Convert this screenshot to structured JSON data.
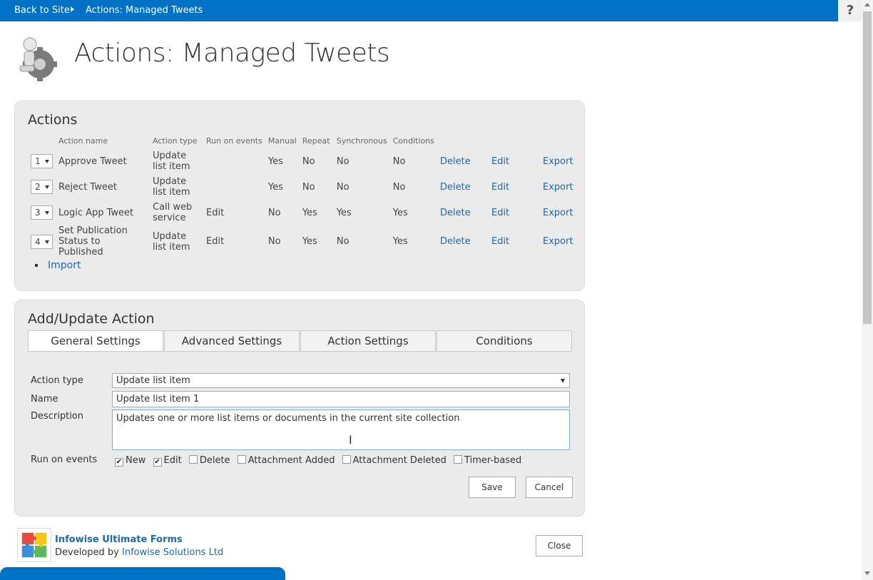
{
  "topbar": {
    "back_label": "Back to Site",
    "breadcrumb": "Actions: Managed Tweets",
    "help": "?"
  },
  "page": {
    "title": "Actions: Managed Tweets"
  },
  "actions_panel": {
    "title": "Actions",
    "columns": [
      "Action name",
      "Action type",
      "Run on events",
      "Manual",
      "Repeat",
      "Synchronous",
      "Conditions"
    ],
    "rows": [
      {
        "order": "1",
        "name": "Approve Tweet",
        "type": "Update list item",
        "run_on_events": "",
        "manual": "Yes",
        "repeat": "No",
        "synchronous": "No",
        "conditions": "No",
        "delete": "Delete",
        "edit": "Edit",
        "export": "Export"
      },
      {
        "order": "2",
        "name": "Reject Tweet",
        "type": "Update list item",
        "run_on_events": "",
        "manual": "Yes",
        "repeat": "No",
        "synchronous": "No",
        "conditions": "No",
        "delete": "Delete",
        "edit": "Edit",
        "export": "Export"
      },
      {
        "order": "3",
        "name": "Logic App Tweet",
        "type": "Call web service",
        "run_on_events": "Edit",
        "manual": "No",
        "repeat": "Yes",
        "synchronous": "Yes",
        "conditions": "Yes",
        "delete": "Delete",
        "edit": "Edit",
        "export": "Export"
      },
      {
        "order": "4",
        "name": "Set Publication Status to Published",
        "type": "Update list item",
        "run_on_events": "Edit",
        "manual": "No",
        "repeat": "Yes",
        "synchronous": "No",
        "conditions": "Yes",
        "delete": "Delete",
        "edit": "Edit",
        "export": "Export"
      }
    ],
    "import_label": "Import"
  },
  "add_update_panel": {
    "title": "Add/Update Action",
    "tabs": [
      "General Settings",
      "Advanced Settings",
      "Action Settings",
      "Conditions"
    ],
    "active_tab": "General Settings",
    "action_type_label": "Action type",
    "action_type_value": "Update list item",
    "name_label": "Name",
    "name_value": "Update list item 1",
    "description_label": "Description",
    "description_value": "Updates one or more list items or documents in the current site collection",
    "run_on_events_label": "Run on events",
    "events": [
      {
        "label": "New",
        "checked": true
      },
      {
        "label": "Edit",
        "checked": true
      },
      {
        "label": "Delete",
        "checked": false
      },
      {
        "label": "Attachment Added",
        "checked": false
      },
      {
        "label": "Attachment Deleted",
        "checked": false
      },
      {
        "label": "Timer-based",
        "checked": false
      }
    ],
    "save_label": "Save",
    "cancel_label": "Cancel"
  },
  "footer": {
    "product": "Infowise Ultimate Forms",
    "developed_by": "Developed by",
    "company": "Infowise Solutions Ltd",
    "close_label": "Close"
  },
  "colors": {
    "topbar": "#0072c6",
    "link": "#1a6aac",
    "panel": "#ebebeb"
  }
}
